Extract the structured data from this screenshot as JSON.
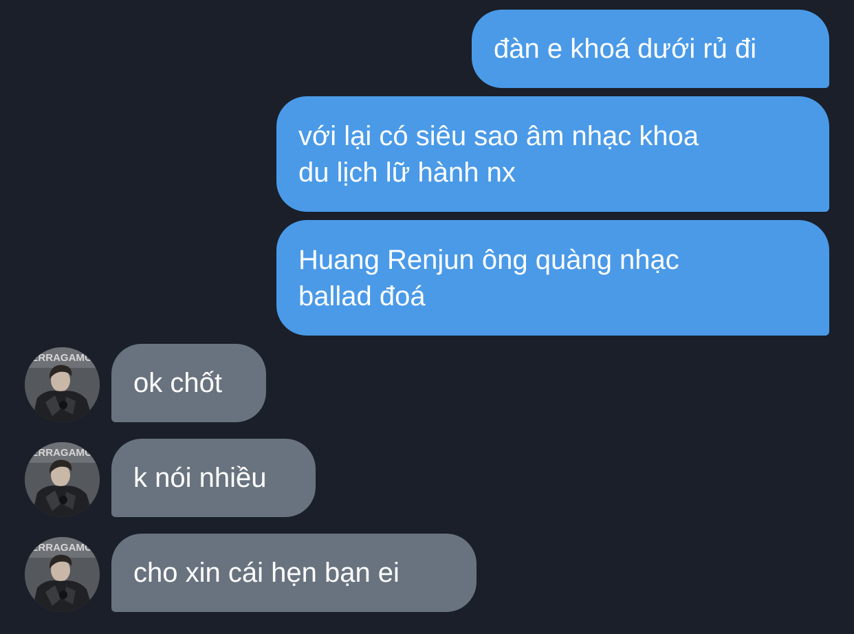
{
  "conversation": {
    "sent_messages": [
      {
        "text": "đàn e khoá dưới rủ đi"
      },
      {
        "line1": "với lại có siêu sao âm nhạc khoa",
        "line2": "du lịch lữ hành nx"
      },
      {
        "line1": "Huang Renjun ông quàng nhạc",
        "line2": "ballad đoá"
      }
    ],
    "received_messages": [
      {
        "text": "ok chốt"
      },
      {
        "text": "k nói nhiều"
      },
      {
        "text": "cho xin cái hẹn bạn ei"
      }
    ],
    "avatar": {
      "icon": "user-photo-avatar",
      "sign_text": "ERRAGAMO"
    }
  },
  "colors": {
    "background": "#1a1f29",
    "sent_bubble": "#4a9ae8",
    "received_bubble": "#69737f",
    "text": "#ffffff"
  }
}
